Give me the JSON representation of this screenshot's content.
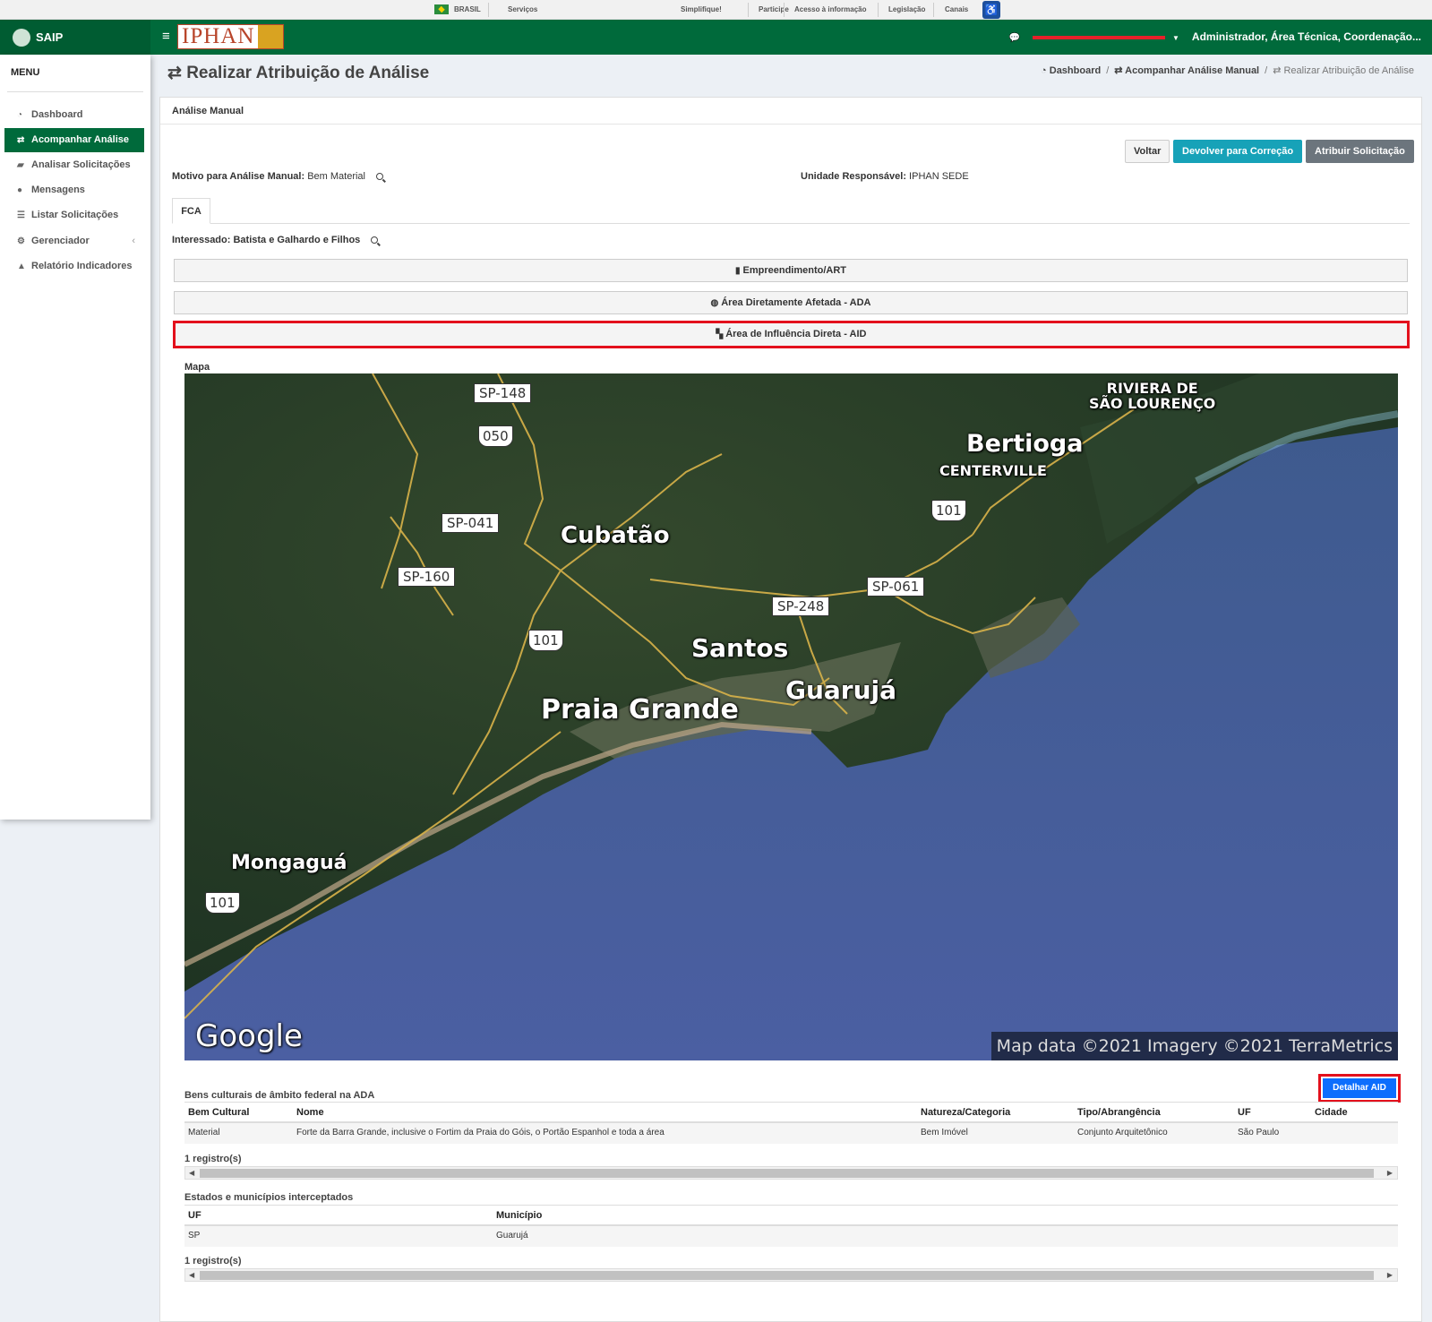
{
  "govbar": {
    "brasil": "BRASIL",
    "servicos": "Serviços",
    "links": [
      "Simplifique!",
      "Participe",
      "Acesso à informação",
      "Legislação",
      "Canais"
    ]
  },
  "header": {
    "app_name": "SAIP",
    "brand": "IPHAN",
    "user_role": "Administrador, Área Técnica, Coordenação..."
  },
  "sidebar": {
    "title": "MENU",
    "items": [
      {
        "label": "Dashboard",
        "icon": "dashboard-icon"
      },
      {
        "label": "Acompanhar Análise",
        "icon": "exchange-icon",
        "active": true
      },
      {
        "label": "Analisar Solicitações",
        "icon": "book-icon"
      },
      {
        "label": "Mensagens",
        "icon": "comments-icon"
      },
      {
        "label": "Listar Solicitações",
        "icon": "list-icon"
      },
      {
        "label": "Gerenciador",
        "icon": "cogs-icon"
      },
      {
        "label": "Relatório Indicadores",
        "icon": "area-chart-icon"
      }
    ]
  },
  "page": {
    "title": "Realizar Atribuição de Análise",
    "breadcrumb": [
      "Dashboard",
      "Acompanhar Análise Manual",
      "Realizar Atribuição de Análise"
    ]
  },
  "panel": {
    "heading": "Análise Manual",
    "buttons": {
      "voltar": "Voltar",
      "devolver": "Devolver para Correção",
      "atribuir": "Atribuir Solicitação"
    },
    "motivo_label": "Motivo para Análise Manual:",
    "motivo_value": "Bem Material",
    "unidade_label": "Unidade Responsável:",
    "unidade_value": "IPHAN SEDE",
    "tab": "FCA",
    "interessado_label": "Interessado:",
    "interessado_value": "Batista e Galhardo e Filhos",
    "accordions": [
      "Empreendimento/ART",
      "Área Diretamente Afetada - ADA",
      "Área de Influência Direta - AID"
    ]
  },
  "map": {
    "label": "Mapa",
    "places": [
      "RIVIERA DE",
      "SÃO LOURENÇO",
      "Bertioga",
      "CENTERVILLE",
      "Cubatão",
      "Santos",
      "Guarujá",
      "Praia Grande",
      "Mongaguá"
    ],
    "roads": [
      "SP-148",
      "050",
      "SP-041",
      "SP-160",
      "101",
      "SP-248",
      "SP-061",
      "101",
      "101"
    ],
    "logo": "Google",
    "attribution": "Map data ©2021 Imagery ©2021 TerraMetrics"
  },
  "detalhar_button": "Detalhar AID",
  "bens_table": {
    "title": "Bens culturais de âmbito federal na ADA",
    "headers": [
      "Bem Cultural",
      "Nome",
      "Natureza/Categoria",
      "Tipo/Abrangência",
      "UF",
      "Cidade"
    ],
    "rows": [
      [
        "Material",
        "Forte da Barra Grande, inclusive o Fortim da Praia do Góis, o Portão Espanhol e toda a área",
        "Bem Imóvel",
        "Conjunto Arquitetônico",
        "São Paulo",
        ""
      ]
    ],
    "count": "1 registro(s)"
  },
  "estados_table": {
    "title": "Estados e municípios interceptados",
    "headers": [
      "UF",
      "Município"
    ],
    "rows": [
      [
        "SP",
        "Guarujá"
      ]
    ],
    "count": "1 registro(s)"
  },
  "colors": {
    "brand_green": "#006a3b",
    "highlight_red": "#e3101c",
    "primary_blue": "#0d6efd",
    "info": "#17a2b8"
  }
}
